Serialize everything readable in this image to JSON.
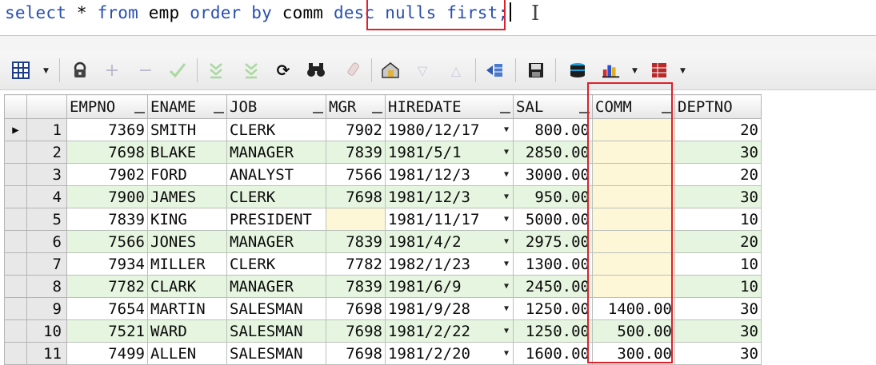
{
  "editor": {
    "sql_parts": [
      "select",
      " * ",
      "from",
      " emp ",
      "order by",
      " comm ",
      "desc",
      " ",
      "nulls first;"
    ]
  },
  "toolbar": {
    "buttons": [
      {
        "name": "grid-view-icon"
      },
      {
        "name": "lock-icon"
      },
      {
        "name": "add-record-icon"
      },
      {
        "name": "delete-record-icon"
      },
      {
        "name": "post-changes-icon"
      },
      {
        "name": "fetch-next-icon"
      },
      {
        "name": "fetch-all-icon"
      },
      {
        "name": "refresh-icon"
      },
      {
        "name": "find-icon"
      },
      {
        "name": "clear-icon"
      },
      {
        "name": "query-by-example-icon"
      },
      {
        "name": "sort-descending-icon"
      },
      {
        "name": "sort-ascending-icon"
      },
      {
        "name": "export-icon"
      },
      {
        "name": "save-icon"
      },
      {
        "name": "connect-icon"
      },
      {
        "name": "chart-icon"
      },
      {
        "name": "table-export-icon"
      }
    ]
  },
  "grid": {
    "columns": [
      "EMPNO",
      "ENAME",
      "JOB",
      "MGR",
      "HIREDATE",
      "SAL",
      "COMM",
      "DEPTNO"
    ],
    "current_row_marker": "▶",
    "rows": [
      {
        "n": "1",
        "empno": "7369",
        "ename": "SMITH",
        "job": "CLERK",
        "mgr": "7902",
        "hiredate": "1980/12/17",
        "sal": "800.00",
        "comm": "",
        "deptno": "20"
      },
      {
        "n": "2",
        "empno": "7698",
        "ename": "BLAKE",
        "job": "MANAGER",
        "mgr": "7839",
        "hiredate": "1981/5/1",
        "sal": "2850.00",
        "comm": "",
        "deptno": "30"
      },
      {
        "n": "3",
        "empno": "7902",
        "ename": "FORD",
        "job": "ANALYST",
        "mgr": "7566",
        "hiredate": "1981/12/3",
        "sal": "3000.00",
        "comm": "",
        "deptno": "20"
      },
      {
        "n": "4",
        "empno": "7900",
        "ename": "JAMES",
        "job": "CLERK",
        "mgr": "7698",
        "hiredate": "1981/12/3",
        "sal": "950.00",
        "comm": "",
        "deptno": "30"
      },
      {
        "n": "5",
        "empno": "7839",
        "ename": "KING",
        "job": "PRESIDENT",
        "mgr": "",
        "hiredate": "1981/11/17",
        "sal": "5000.00",
        "comm": "",
        "deptno": "10"
      },
      {
        "n": "6",
        "empno": "7566",
        "ename": "JONES",
        "job": "MANAGER",
        "mgr": "7839",
        "hiredate": "1981/4/2",
        "sal": "2975.00",
        "comm": "",
        "deptno": "20"
      },
      {
        "n": "7",
        "empno": "7934",
        "ename": "MILLER",
        "job": "CLERK",
        "mgr": "7782",
        "hiredate": "1982/1/23",
        "sal": "1300.00",
        "comm": "",
        "deptno": "10"
      },
      {
        "n": "8",
        "empno": "7782",
        "ename": "CLARK",
        "job": "MANAGER",
        "mgr": "7839",
        "hiredate": "1981/6/9",
        "sal": "2450.00",
        "comm": "",
        "deptno": "10"
      },
      {
        "n": "9",
        "empno": "7654",
        "ename": "MARTIN",
        "job": "SALESMAN",
        "mgr": "7698",
        "hiredate": "1981/9/28",
        "sal": "1250.00",
        "comm": "1400.00",
        "deptno": "30"
      },
      {
        "n": "10",
        "empno": "7521",
        "ename": "WARD",
        "job": "SALESMAN",
        "mgr": "7698",
        "hiredate": "1981/2/22",
        "sal": "1250.00",
        "comm": "500.00",
        "deptno": "30"
      },
      {
        "n": "11",
        "empno": "7499",
        "ename": "ALLEN",
        "job": "SALESMAN",
        "mgr": "7698",
        "hiredate": "1981/2/20",
        "sal": "1600.00",
        "comm": "300.00",
        "deptno": "30"
      }
    ]
  },
  "colors": {
    "highlight": "#e0202a",
    "row_alt": "#e6f5e0",
    "null_cell": "#fdf7d8"
  }
}
